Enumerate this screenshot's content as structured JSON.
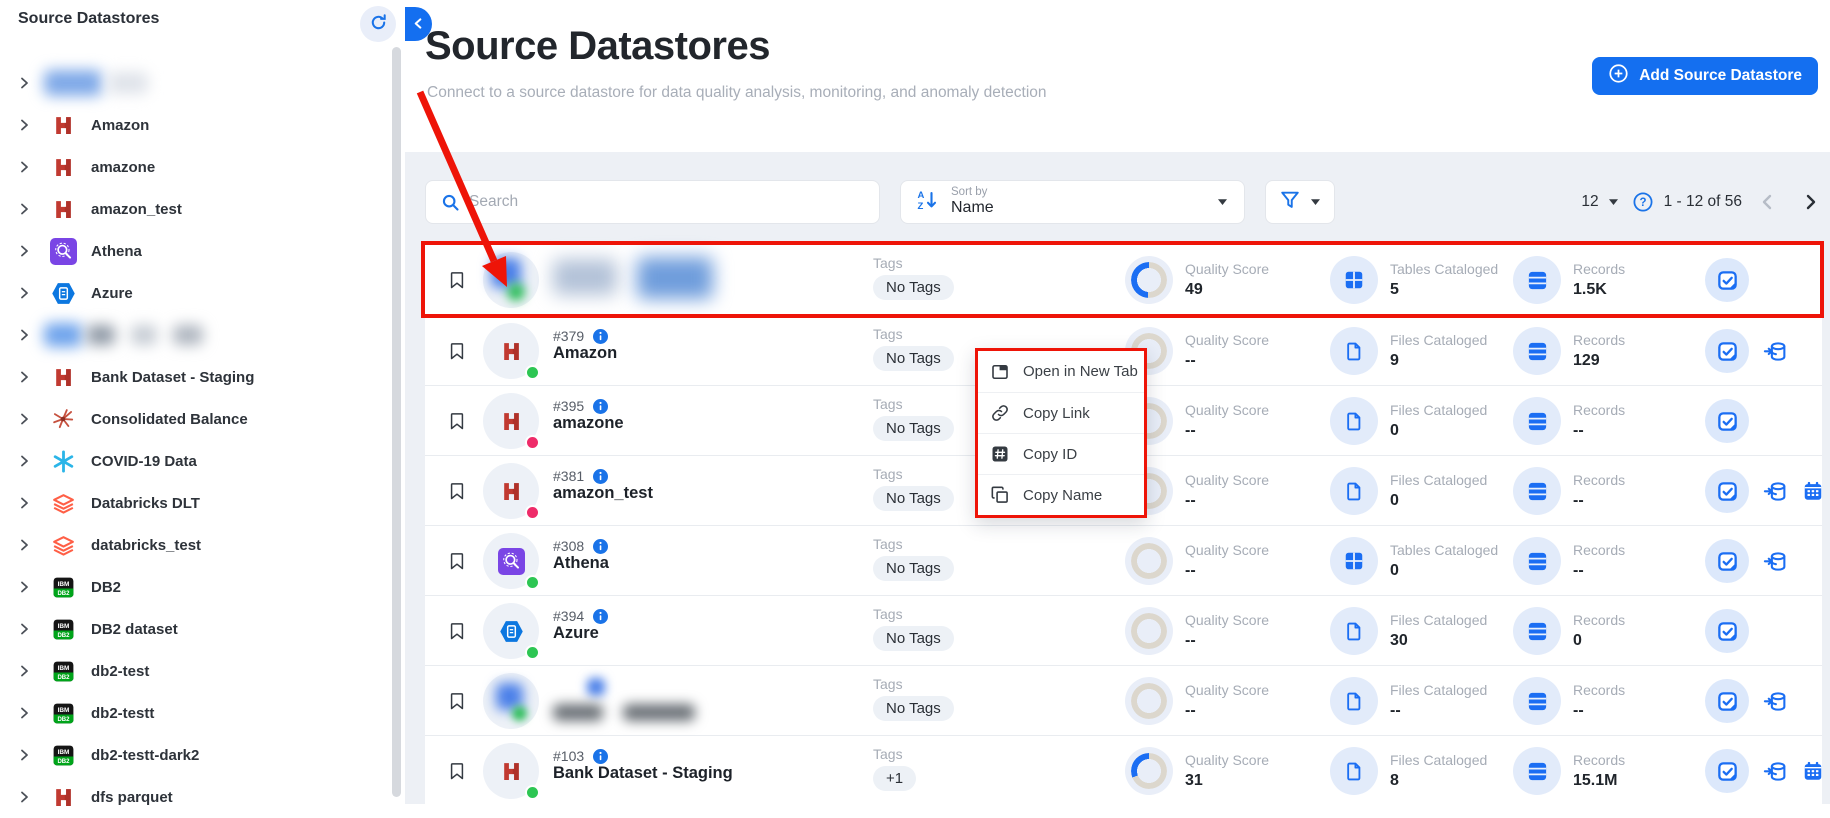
{
  "colors": {
    "accent": "#146ff0",
    "icon_blue": "#1b6ef3",
    "annotation": "#ee1408",
    "green": "#2dc653",
    "pink": "#ee2b69"
  },
  "sidebar": {
    "title": "Source Datastores",
    "items": [
      {
        "label": "",
        "icon": "blurred",
        "blurred": true,
        "blob_style": "b1"
      },
      {
        "label": "Amazon",
        "icon": "aws-red"
      },
      {
        "label": "amazone",
        "icon": "aws-red"
      },
      {
        "label": "amazon_test",
        "icon": "aws-red"
      },
      {
        "label": "Athena",
        "icon": "athena"
      },
      {
        "label": "Azure",
        "icon": "azure"
      },
      {
        "label": "",
        "icon": "blurred",
        "blurred": true,
        "blob_style": "b7"
      },
      {
        "label": "Bank Dataset - Staging",
        "icon": "aws-red"
      },
      {
        "label": "Consolidated Balance",
        "icon": "spark"
      },
      {
        "label": "COVID-19 Data",
        "icon": "snowflake"
      },
      {
        "label": "Databricks DLT",
        "icon": "databricks"
      },
      {
        "label": "databricks_test",
        "icon": "databricks"
      },
      {
        "label": "DB2",
        "icon": "db2"
      },
      {
        "label": "DB2 dataset",
        "icon": "db2"
      },
      {
        "label": "db2-test",
        "icon": "db2"
      },
      {
        "label": "db2-testt",
        "icon": "db2"
      },
      {
        "label": "db2-testt-dark2",
        "icon": "db2"
      },
      {
        "label": "dfs parquet",
        "icon": "aws-red"
      }
    ]
  },
  "header": {
    "title": "Source Datastores",
    "subtitle": "Connect to a source datastore for data quality analysis, monitoring, and anomaly detection",
    "add_button": "Add Source Datastore"
  },
  "toolbar": {
    "search_placeholder": "Search",
    "sort_label": "Sort by",
    "sort_value": "Name",
    "page_size": "12",
    "range": "1 - 12 of 56"
  },
  "columns": {
    "tags": "Tags",
    "quality": "Quality Score",
    "records": "Records"
  },
  "rows": [
    {
      "id": "",
      "name": "",
      "blurred": true,
      "blob_style": "r1",
      "icon": "blurred",
      "status": "green",
      "tags": "No Tags",
      "quality": "49",
      "quality_pct": 49,
      "catalog_label": "Tables Cataloged",
      "catalog_icon": "table",
      "catalog": "5",
      "records": "1.5K",
      "actions": [
        "checks"
      ],
      "highlighted": true
    },
    {
      "id": "#379",
      "name": "Amazon",
      "icon": "aws-red",
      "status": "green",
      "tags": "No Tags",
      "quality": "--",
      "quality_pct": null,
      "catalog_label": "Files Cataloged",
      "catalog_icon": "file",
      "catalog": "9",
      "records": "129",
      "actions": [
        "checks",
        "scan"
      ]
    },
    {
      "id": "#395",
      "name": "amazone",
      "icon": "aws-red",
      "status": "pink",
      "tags": "No Tags",
      "quality": "--",
      "quality_pct": null,
      "catalog_label": "Files Cataloged",
      "catalog_icon": "file",
      "catalog": "0",
      "records": "--",
      "actions": [
        "checks"
      ]
    },
    {
      "id": "#381",
      "name": "amazon_test",
      "icon": "aws-red",
      "status": "pink",
      "tags": "No Tags",
      "quality": "--",
      "quality_pct": null,
      "catalog_label": "Files Cataloged",
      "catalog_icon": "file",
      "catalog": "0",
      "records": "--",
      "actions": [
        "checks",
        "scan",
        "calendar"
      ]
    },
    {
      "id": "#308",
      "name": "Athena",
      "icon": "athena",
      "status": "green",
      "tags": "No Tags",
      "quality": "--",
      "quality_pct": null,
      "catalog_label": "Tables Cataloged",
      "catalog_icon": "table",
      "catalog": "0",
      "records": "--",
      "actions": [
        "checks",
        "scan"
      ]
    },
    {
      "id": "#394",
      "name": "Azure",
      "icon": "azure",
      "status": "green",
      "tags": "No Tags",
      "quality": "--",
      "quality_pct": null,
      "catalog_label": "Files Cataloged",
      "catalog_icon": "file",
      "catalog": "30",
      "records": "0",
      "actions": [
        "checks"
      ]
    },
    {
      "id": "",
      "name": "",
      "blurred": true,
      "blob_style": "r7",
      "icon": "blurred",
      "status": "green",
      "tags": "No Tags",
      "quality": "--",
      "quality_pct": null,
      "catalog_label": "Files Cataloged",
      "catalog_icon": "file",
      "catalog": "--",
      "records": "--",
      "actions": [
        "checks",
        "scan"
      ]
    },
    {
      "id": "#103",
      "name": "Bank Dataset - Staging",
      "icon": "aws-red",
      "status": "green",
      "tags": "+1",
      "quality": "31",
      "quality_pct": 31,
      "catalog_label": "Files Cataloged",
      "catalog_icon": "file",
      "catalog": "8",
      "records": "15.1M",
      "actions": [
        "checks",
        "scan",
        "calendar"
      ]
    }
  ],
  "context_menu": {
    "items": [
      {
        "label": "Open in New Tab",
        "icon": "new-tab"
      },
      {
        "label": "Copy Link",
        "icon": "link"
      },
      {
        "label": "Copy ID",
        "icon": "hash"
      },
      {
        "label": "Copy Name",
        "icon": "copy"
      }
    ]
  }
}
